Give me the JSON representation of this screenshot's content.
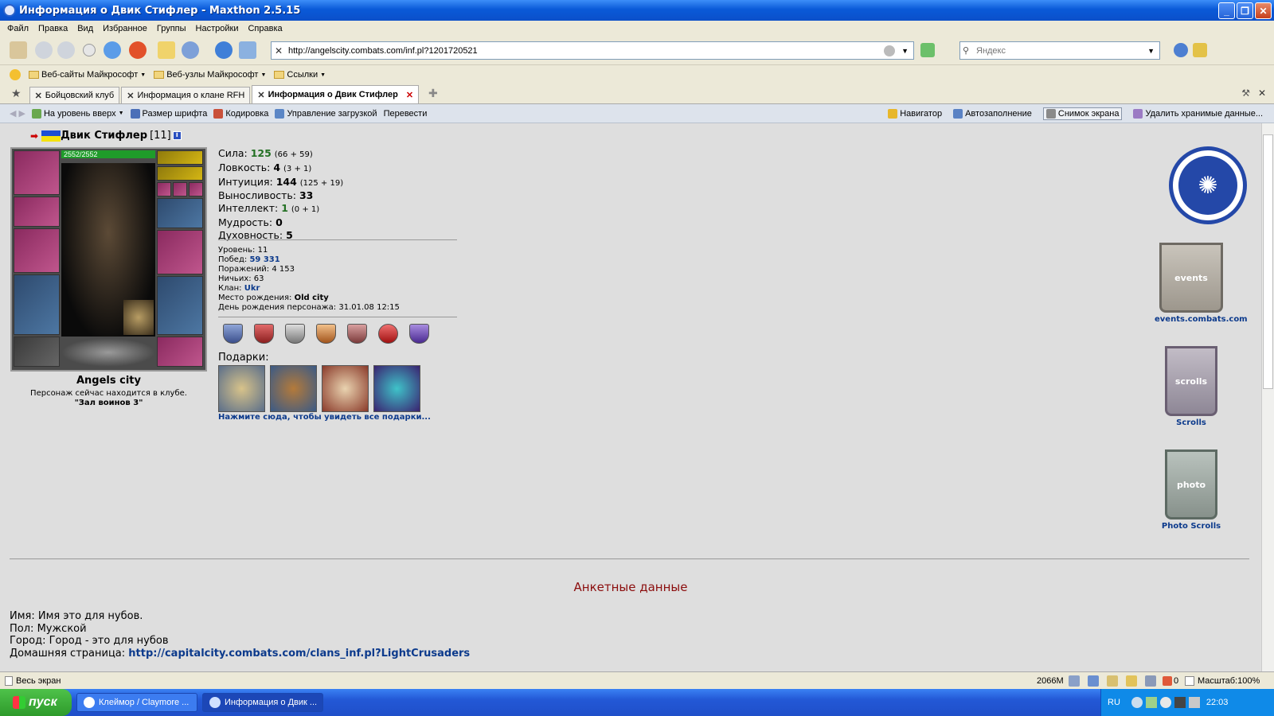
{
  "window": {
    "title": "Информация о Двик Стифлер - Maxthon 2.5.15"
  },
  "menu": [
    "Файл",
    "Правка",
    "Вид",
    "Избранное",
    "Группы",
    "Настройки",
    "Справка"
  ],
  "address": {
    "url": "http://angelscity.combats.com/inf.pl?1201720521"
  },
  "search": {
    "placeholder": "Яндекс"
  },
  "favorites": [
    {
      "label": "Веб-сайты Майкрософт"
    },
    {
      "label": "Веб-узлы Майкрософт"
    },
    {
      "label": "Ссылки"
    }
  ],
  "tabs": [
    {
      "label": "Бойцовский клуб"
    },
    {
      "label": "Информация о клане RFH"
    },
    {
      "label": "Информация о Двик Стифлер"
    }
  ],
  "subtoolbar": {
    "left": [
      "На уровень вверх",
      "Размер шрифта",
      "Кодировка",
      "Управление загрузкой",
      "Перевести"
    ],
    "right": [
      "Навигатор",
      "Автозаполнение",
      "Снимок экрана",
      "Удалить хранимые данные..."
    ]
  },
  "character": {
    "name": "Двик Стифлер",
    "level": "[11]",
    "info_badge": "i",
    "hp": "2552/2552",
    "city": "Angels city",
    "location_text": "Персонаж сейчас находится в клубе.",
    "room": "\"Зал воинов 3\""
  },
  "stats": [
    {
      "label": "Сила:",
      "value": "125",
      "extra": "(66 + 59)",
      "green": true
    },
    {
      "label": "Ловкость:",
      "value": "4",
      "extra": "(3 + 1)",
      "green": false
    },
    {
      "label": "Интуиция:",
      "value": "144",
      "extra": "(125 + 19)",
      "green": false
    },
    {
      "label": "Выносливость:",
      "value": "33",
      "extra": "",
      "green": false
    },
    {
      "label": "Интеллект:",
      "value": "1",
      "extra": "(0 + 1)",
      "green": true
    },
    {
      "label": "Мудрость:",
      "value": "0",
      "extra": "",
      "green": false
    },
    {
      "label": "Духовность:",
      "value": "5",
      "extra": "",
      "green": false
    }
  ],
  "meta": {
    "level_label": "Уровень:",
    "level": "11",
    "wins_label": "Побед:",
    "wins": "59 331",
    "losses_label": "Поражений:",
    "losses": "4 153",
    "draws_label": "Ничьих:",
    "draws": "63",
    "clan_label": "Клан:",
    "clan": "Ukr",
    "birthplace_label": "Место рождения:",
    "birthplace": "Old city",
    "birthday_label": "День рождения персонажа:",
    "birthday": "31.01.08 12:15"
  },
  "gifts": {
    "title": "Подарки:",
    "link": "Нажмите сюда, чтобы увидеть все подарки..."
  },
  "sidebar": {
    "events": "events.combats.com",
    "scrolls": "Scrolls",
    "photo": "Photo Scrolls",
    "events_banner": "events",
    "scrolls_banner": "scrolls",
    "photo_banner": "photo"
  },
  "profile": {
    "heading": "Анкетные данные",
    "name_label": "Имя:",
    "name": "Имя это для нубов.",
    "sex_label": "Пол:",
    "sex": "Мужской",
    "city_label": "Город:",
    "city": "Город - это для нубов",
    "home_label": "Домашняя страница:",
    "home": "http://capitalcity.combats.com/clans_inf.pl?LightCrusaders"
  },
  "status": {
    "left": "Весь экран",
    "memory": "2066M",
    "count": "0",
    "zoom": "Масштаб:100%"
  },
  "taskbar": {
    "start": "пуск",
    "tasks": [
      "Клеймор / Claymore ...",
      "Информация о Двик ..."
    ],
    "lang": "RU",
    "time": "22:03"
  }
}
